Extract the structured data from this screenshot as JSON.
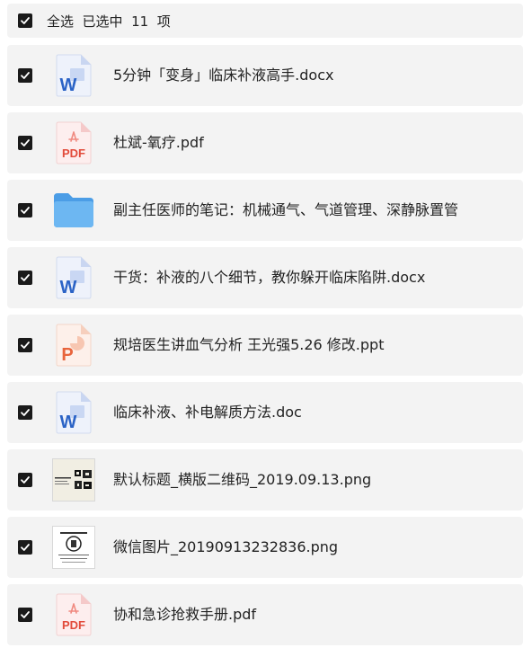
{
  "header": {
    "select_all_label": "全选  已选中  11  项"
  },
  "files": [
    {
      "name": "5分钟「变身」临床补液高手.docx",
      "icon": "word-doc-icon"
    },
    {
      "name": "杜斌-氧疗.pdf",
      "icon": "pdf-icon"
    },
    {
      "name": "副主任医师的笔记：机械通气、气道管理、深静脉置管",
      "icon": "folder-icon"
    },
    {
      "name": "干货：补液的八个细节，教你躲开临床陷阱.docx",
      "icon": "word-doc-icon"
    },
    {
      "name": "规培医生讲血气分析 王光强5.26 修改.ppt",
      "icon": "powerpoint-icon"
    },
    {
      "name": "临床补液、补电解质方法.doc",
      "icon": "word-doc-icon"
    },
    {
      "name": "默认标题_横版二维码_2019.09.13.png",
      "icon": "image-thumbnail"
    },
    {
      "name": "微信图片_20190913232836.png",
      "icon": "image-thumbnail"
    },
    {
      "name": "协和急诊抢救手册.pdf",
      "icon": "pdf-icon"
    }
  ],
  "icon_text": {
    "word": "W",
    "pdf": "PDF",
    "ppt": "P"
  },
  "colors": {
    "row_background": "#f3f3f3",
    "checkbox": "#1a1a1a",
    "word_blue": "#2b63c6",
    "pdf_red": "#e24b3b",
    "ppt_orange": "#e8643c",
    "folder_blue": "#5aa9ee"
  }
}
